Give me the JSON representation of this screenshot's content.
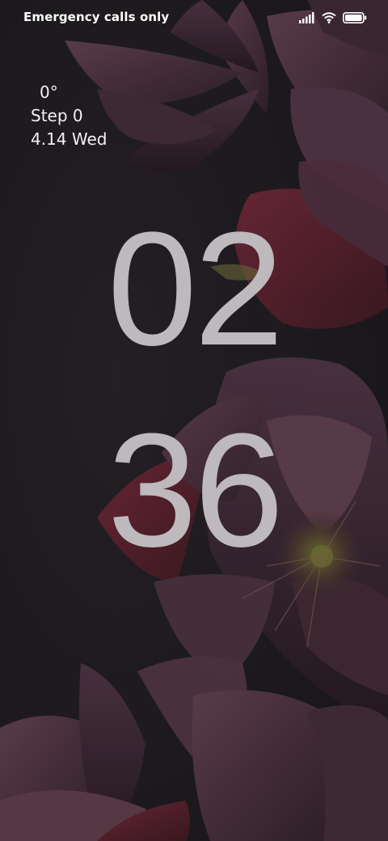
{
  "status_bar": {
    "carrier_text": "Emergency calls only",
    "icons": [
      "signal-icon",
      "wifi-icon",
      "battery-icon"
    ]
  },
  "info": {
    "temperature": "0°",
    "steps": "Step 0",
    "date": "4.14 Wed"
  },
  "clock": {
    "hours": "02",
    "minutes": "36"
  },
  "colors": {
    "background": "#1f1c20",
    "flower_dark": "#3a2630",
    "flower_mid": "#5a3a48",
    "flower_red": "#5e2430",
    "clock_text": "#bdb9bc",
    "status_text": "#ffffff"
  }
}
